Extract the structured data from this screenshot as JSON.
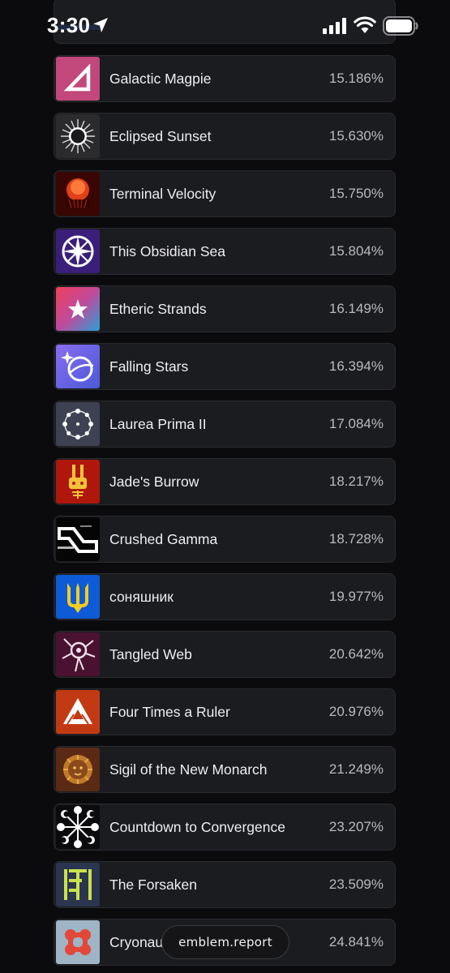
{
  "status_bar": {
    "time": "3:30",
    "icons": [
      "location-arrow-icon",
      "cellular-signal-icon",
      "wifi-icon",
      "battery-icon"
    ]
  },
  "emblems": [
    {
      "name": "Galactic Magpie",
      "percent": "15.186%",
      "icon": "triangle-icon",
      "color": "#c2477a"
    },
    {
      "name": "Eclipsed Sunset",
      "percent": "15.630%",
      "icon": "eclipse-sun-icon",
      "color": "#2b2b2e"
    },
    {
      "name": "Terminal Velocity",
      "percent": "15.750%",
      "icon": "red-orb-icon",
      "color": "#5a0a06"
    },
    {
      "name": "This Obsidian Sea",
      "percent": "15.804%",
      "icon": "compass-star-icon",
      "color": "#3a1f7a"
    },
    {
      "name": "Etheric Strands",
      "percent": "16.149%",
      "icon": "star-icon",
      "color": "#d7467a"
    },
    {
      "name": "Falling Stars",
      "percent": "16.394%",
      "icon": "planet-star-icon",
      "color": "#6b5bd8"
    },
    {
      "name": "Laurea Prima II",
      "percent": "17.084%",
      "icon": "orbit-ring-icon",
      "color": "#3d4152"
    },
    {
      "name": "Jade's Burrow",
      "percent": "18.217%",
      "icon": "rabbit-icon",
      "color": "#b0170c"
    },
    {
      "name": "Crushed Gamma",
      "percent": "18.728%",
      "icon": "glitch-glyph-icon",
      "color": "#050505"
    },
    {
      "name": "соняшник",
      "percent": "19.977%",
      "icon": "trident-icon",
      "color": "#0d5bd6"
    },
    {
      "name": "Tangled Web",
      "percent": "20.642%",
      "icon": "web-sigil-icon",
      "color": "#4a1230"
    },
    {
      "name": "Four Times a Ruler",
      "percent": "20.976%",
      "icon": "triangle-mountain-icon",
      "color": "#c23a14"
    },
    {
      "name": "Sigil of the New Monarch",
      "percent": "21.249%",
      "icon": "lion-crest-icon",
      "color": "#5a2a14"
    },
    {
      "name": "Countdown to Convergence",
      "percent": "23.207%",
      "icon": "convergence-icon",
      "color": "#0b0b0d"
    },
    {
      "name": "The Forsaken",
      "percent": "23.509%",
      "icon": "forsaken-glyph-icon",
      "color": "#2b3550"
    },
    {
      "name": "Cryonau",
      "percent": "24.841%",
      "icon": "cryo-knot-icon",
      "color": "#9fb4c4"
    }
  ],
  "site_pill": {
    "label": "emblem.report"
  }
}
